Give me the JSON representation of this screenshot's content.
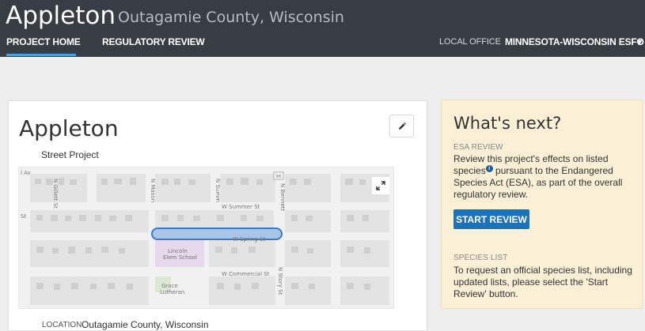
{
  "header": {
    "city": "Appleton",
    "county": "Outagamie County, Wisconsin",
    "tabs": [
      {
        "label": "PROJECT HOME",
        "active": true
      },
      {
        "label": "REGULATORY REVIEW",
        "active": false
      }
    ],
    "office_label": "LOCAL OFFICE",
    "office_value": "MINNESOTA-WISCONSIN ESFO",
    "office_caret": "▾",
    "accent_color": "#4aa0d8",
    "bg_color": "#373d42"
  },
  "project": {
    "name": "Appleton",
    "type": "Street Project",
    "edit_icon": "pencil-icon",
    "expand_icon": "expand-icon",
    "location_label": "LOCATION",
    "location_value": "Outagamie County, Wisconsin",
    "map": {
      "streets": [
        "N Gillett St",
        "N Mason",
        "N Summ",
        "N Bennett",
        "W Summer St",
        "W Spring St",
        "W Commercial St",
        "N Story St"
      ],
      "places": [
        "Lincoln",
        "Elem School",
        "Grace",
        "Lutheran"
      ],
      "edge_labels": [
        "l Av",
        "St"
      ],
      "route_shield": "96"
    }
  },
  "next": {
    "title": "What's next?",
    "esa_label": "ESA REVIEW",
    "esa_text_1": "Review this project's effects on listed species",
    "esa_text_2": " pursuant to the Endangered Species Act (ESA), as part of the overall regulatory review.",
    "info_glyph": "i",
    "start_button": "START REVIEW",
    "species_label": "SPECIES LIST",
    "species_text": "To request an official species list, including updated lists, please select the 'Start Review' button.",
    "button_color": "#1a72b8",
    "panel_color": "#fbefd6"
  }
}
